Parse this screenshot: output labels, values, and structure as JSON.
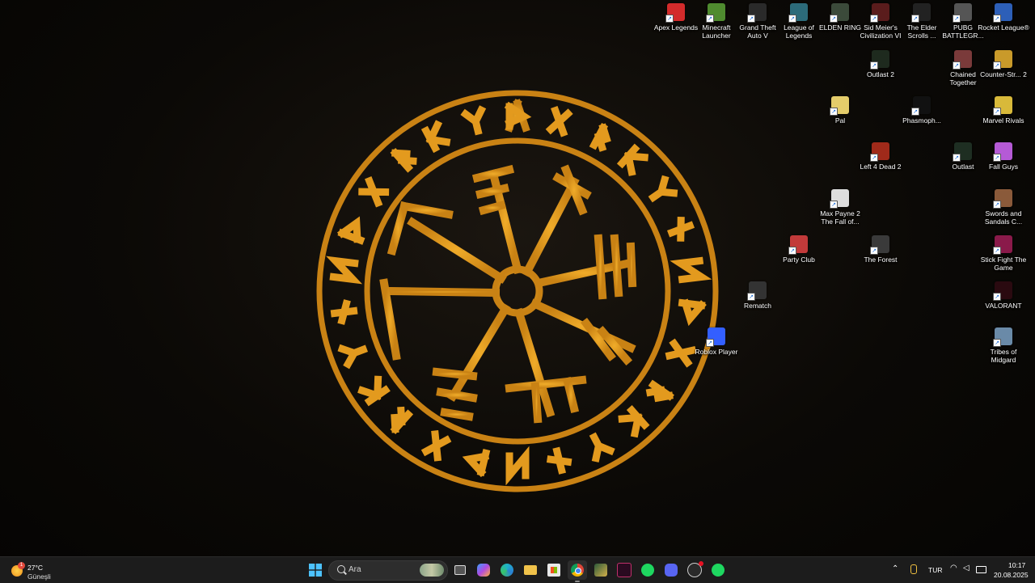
{
  "desktop": {
    "icons": [
      {
        "label": "Apex Legends",
        "icon": "apex-icon",
        "color": "#d32b2b"
      },
      {
        "label": "Minecraft Launcher",
        "icon": "minecraft-icon",
        "color": "#4f8b2f"
      },
      {
        "label": "Grand Theft Auto V",
        "icon": "gta-icon",
        "color": "#2a2a2a"
      },
      {
        "label": "League of Legends",
        "icon": "league-icon",
        "color": "#2c6b7a"
      },
      {
        "label": "ELDEN RING",
        "icon": "elden-ring-icon",
        "color": "#3b4a3a"
      },
      {
        "label": "Sid Meier's Civilization VI",
        "icon": "civilization-icon",
        "color": "#5a1c1c"
      },
      {
        "label": "The Elder Scrolls ...",
        "icon": "elder-scrolls-icon",
        "color": "#222222"
      },
      {
        "label": "PUBG BATTLEGR...",
        "icon": "pubg-icon",
        "color": "#555555"
      },
      {
        "label": "Rocket League®",
        "icon": "rocket-league-icon",
        "color": "#2d5fb8"
      },
      {
        "label": "Outlast 2",
        "icon": "outlast-2-icon",
        "color": "#1e2a1e"
      },
      {
        "label": "Chained Together",
        "icon": "chained-together-icon",
        "color": "#7a3a3a"
      },
      {
        "label": "Counter-Str... 2",
        "icon": "counter-strike-icon",
        "color": "#c99a2a"
      },
      {
        "label": "Pal",
        "icon": "palworld-icon",
        "color": "#e4cc6a"
      },
      {
        "label": "Phasmoph...",
        "icon": "phasmophobia-icon",
        "color": "#111111"
      },
      {
        "label": "Marvel Rivals",
        "icon": "marvel-rivals-icon",
        "color": "#d8b93a"
      },
      {
        "label": "Left 4 Dead 2",
        "icon": "left-4-dead-icon",
        "color": "#a02a1a"
      },
      {
        "label": "Outlast",
        "icon": "outlast-icon",
        "color": "#1e2e22"
      },
      {
        "label": "Fall Guys",
        "icon": "fall-guys-icon",
        "color": "#b55ad6"
      },
      {
        "label": "Max Payne 2 The Fall of...",
        "icon": "max-payne-icon",
        "color": "#dddddd"
      },
      {
        "label": "Swords and Sandals C...",
        "icon": "swords-and-sandals-icon",
        "color": "#8a5a3a"
      },
      {
        "label": "Party Club",
        "icon": "party-club-icon",
        "color": "#c23a3a"
      },
      {
        "label": "The Forest",
        "icon": "the-forest-icon",
        "color": "#3a3a3a"
      },
      {
        "label": "Stick Fight The Game",
        "icon": "stick-fight-icon",
        "color": "#8a1a4a"
      },
      {
        "label": "Rematch",
        "icon": "rematch-icon",
        "color": "#333333"
      },
      {
        "label": "VALORANT",
        "icon": "valorant-icon",
        "color": "#2a0a10"
      },
      {
        "label": "Roblox Player",
        "icon": "roblox-icon",
        "color": "#335fff"
      },
      {
        "label": "Tribes of Midgard",
        "icon": "tribes-of-midgard-icon",
        "color": "#6a8aa8"
      }
    ]
  },
  "weather": {
    "temp": "27°C",
    "condition": "Güneşli",
    "badge": "1"
  },
  "search": {
    "placeholder": "Ara"
  },
  "taskbar_apps": [
    {
      "name": "start",
      "icon": "windows-icon"
    },
    {
      "name": "search",
      "icon": "search-icon"
    },
    {
      "name": "task-view",
      "icon": "task-view-icon"
    },
    {
      "name": "copilot",
      "icon": "copilot-icon"
    },
    {
      "name": "edge",
      "icon": "edge-icon"
    },
    {
      "name": "file-explorer",
      "icon": "folder-icon"
    },
    {
      "name": "store",
      "icon": "store-icon"
    },
    {
      "name": "chrome",
      "icon": "chrome-icon"
    },
    {
      "name": "app-green",
      "icon": "app-icon"
    },
    {
      "name": "app-purple",
      "icon": "app-icon"
    },
    {
      "name": "spotify",
      "icon": "spotify-icon"
    },
    {
      "name": "discord",
      "icon": "discord-icon"
    },
    {
      "name": "steam",
      "icon": "steam-icon"
    },
    {
      "name": "spotify-2",
      "icon": "spotify-icon"
    }
  ],
  "tray": {
    "language": "TUR",
    "time": "10:17",
    "date": "20.08.2025"
  },
  "colors": {
    "taskbar": "#1c1c1c",
    "rune": "#e39a1e"
  }
}
